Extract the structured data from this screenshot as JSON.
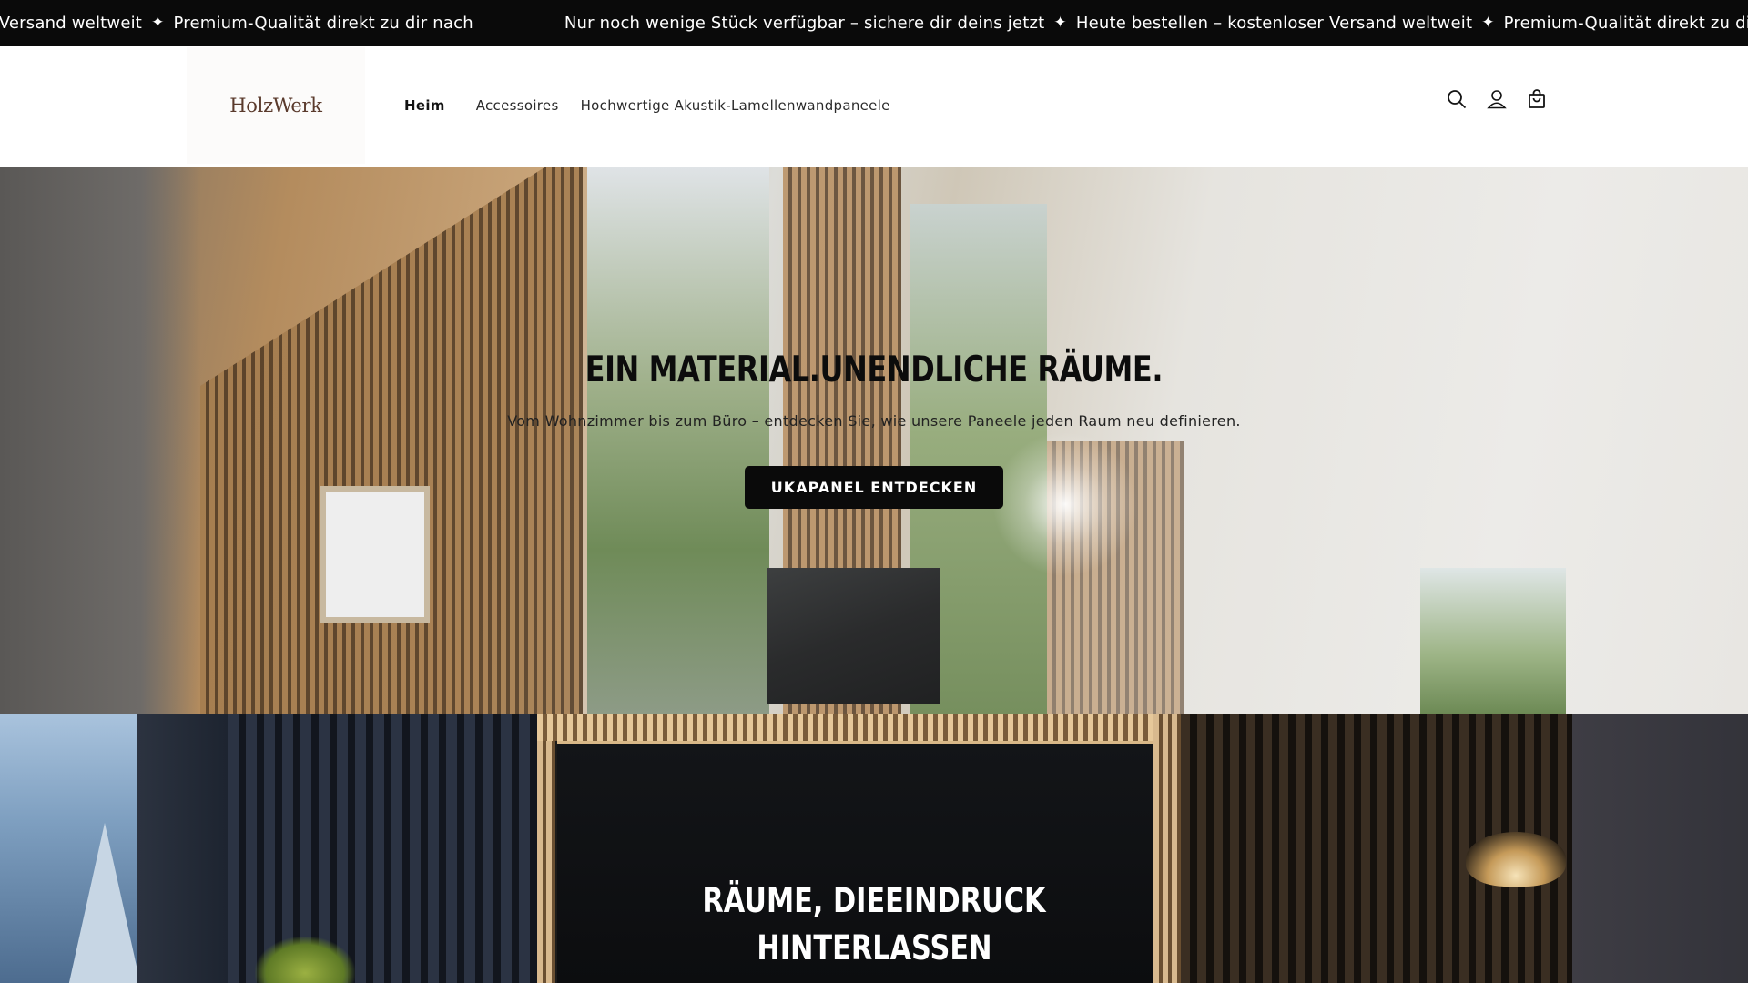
{
  "announcement": {
    "items": [
      "Nur noch wenige Stück verfügbar – sichere dir deins jetzt",
      "Heute bestellen – kostenloser Versand weltweit",
      "Premium-Qualität direkt zu dir nach"
    ],
    "lead_fragment": "er Versand weltweit",
    "separator": "✦"
  },
  "header": {
    "logo": "HolzWerk",
    "nav": [
      {
        "label": "Heim",
        "active": true
      },
      {
        "label": "Accessoires",
        "active": false
      },
      {
        "label": "Hochwertige Akustik-Lamellenwandpaneele",
        "active": false
      }
    ],
    "icons": [
      "search-icon",
      "account-icon",
      "cart-icon"
    ]
  },
  "hero": {
    "title": "EIN MATERIAL.UNENDLICHE RÄUME.",
    "subtitle": "Vom Wohnzimmer bis zum Büro – entdecken Sie, wie unsere Paneele jeden Raum neu definieren.",
    "button": "UKAPANEL ENTDECKEN"
  },
  "hero2": {
    "title_line1": "RÄUME, DIEEINDRUCK",
    "title_line2": "HINTERLASSEN"
  },
  "colors": {
    "announcement_bg": "#0a0a0a",
    "button_bg": "#0a0a0a",
    "logo": "#5a3a2c"
  }
}
